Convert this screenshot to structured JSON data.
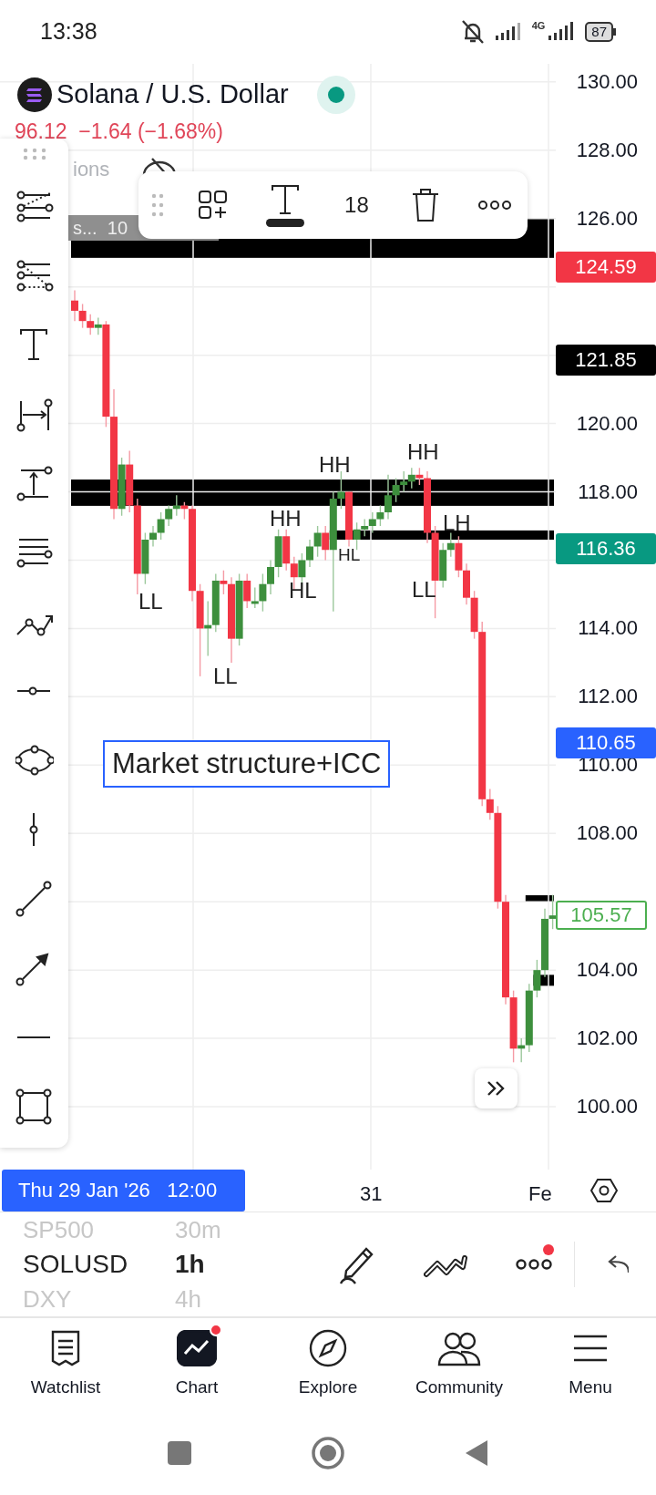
{
  "status_bar": {
    "time": "13:38",
    "network": "4G",
    "battery": "87"
  },
  "header": {
    "title": "Solana / U.S. Dollar",
    "live": true,
    "change": "96.12  −1.64 (−1.68%)"
  },
  "legend": [
    {
      "text": "ions",
      "kind": "plain"
    },
    {
      "text": "s...  10",
      "kind": "tag"
    }
  ],
  "drawing_toolbar": {
    "font_size": "18"
  },
  "chart_data": {
    "type": "candlestick",
    "ylim": [
      98.16,
      130.53
    ],
    "yticks": [
      {
        "value": 130,
        "label": "130.00"
      },
      {
        "value": 128,
        "label": "128.00"
      },
      {
        "value": 126,
        "label": "126.00"
      },
      {
        "value": 120,
        "label": "120.00"
      },
      {
        "value": 118,
        "label": "118.00"
      },
      {
        "value": 114,
        "label": "114.00"
      },
      {
        "value": 112,
        "label": "112.00"
      },
      {
        "value": 110,
        "label": "110.00"
      },
      {
        "value": 108,
        "label": "108.00"
      },
      {
        "value": 104,
        "label": "104.00"
      },
      {
        "value": 102,
        "label": "102.00"
      },
      {
        "value": 100,
        "label": "100.00"
      }
    ],
    "grid": true,
    "categories": [
      null,
      null,
      null,
      null,
      null,
      null,
      null,
      null,
      null,
      null,
      null,
      null,
      null,
      null,
      null,
      null,
      null,
      null,
      null,
      null,
      null,
      null,
      null,
      null,
      null,
      null,
      null,
      null,
      null,
      null,
      null,
      null,
      null,
      null,
      null,
      null,
      null,
      null,
      null,
      null,
      null,
      null,
      null,
      null,
      null,
      null,
      null,
      null,
      null,
      null,
      null,
      null,
      null,
      null,
      null,
      null,
      null,
      null,
      null,
      null,
      null,
      null
    ],
    "ohlc": [
      [
        123.6,
        123.9,
        123.0,
        123.3
      ],
      [
        123.3,
        123.5,
        122.8,
        123.0
      ],
      [
        123.0,
        123.2,
        122.6,
        122.8
      ],
      [
        122.8,
        123.1,
        122.6,
        122.9
      ],
      [
        122.9,
        123.0,
        119.9,
        120.2
      ],
      [
        120.2,
        121.0,
        117.2,
        117.5
      ],
      [
        117.5,
        119.0,
        117.3,
        118.8
      ],
      [
        118.8,
        119.2,
        117.4,
        117.6
      ],
      [
        117.6,
        117.8,
        115.0,
        115.6
      ],
      [
        115.6,
        116.8,
        115.3,
        116.6
      ],
      [
        116.6,
        117.0,
        116.4,
        116.8
      ],
      [
        116.8,
        117.4,
        116.6,
        117.2
      ],
      [
        117.2,
        117.6,
        117.0,
        117.5
      ],
      [
        117.5,
        117.9,
        117.3,
        117.6
      ],
      [
        117.6,
        117.7,
        117.2,
        117.5
      ],
      [
        117.5,
        117.6,
        114.8,
        115.1
      ],
      [
        115.1,
        115.3,
        112.6,
        114.0
      ],
      [
        114.0,
        114.8,
        113.2,
        114.1
      ],
      [
        114.1,
        115.6,
        113.9,
        115.4
      ],
      [
        115.4,
        115.7,
        115.0,
        115.3
      ],
      [
        115.3,
        115.5,
        113.0,
        113.7
      ],
      [
        113.7,
        115.6,
        113.5,
        115.4
      ],
      [
        115.4,
        115.6,
        114.6,
        114.8
      ],
      [
        114.8,
        115.2,
        114.6,
        114.8
      ],
      [
        114.8,
        115.6,
        114.5,
        115.3
      ],
      [
        115.3,
        116.0,
        115.0,
        115.8
      ],
      [
        115.8,
        116.9,
        115.5,
        116.7
      ],
      [
        116.7,
        116.9,
        115.7,
        115.9
      ],
      [
        115.9,
        116.1,
        115.1,
        115.5
      ],
      [
        115.5,
        116.2,
        115.2,
        116.0
      ],
      [
        116.0,
        116.6,
        115.8,
        116.4
      ],
      [
        116.4,
        117.0,
        116.1,
        116.8
      ],
      [
        116.8,
        117.0,
        116.0,
        116.3
      ],
      [
        116.3,
        118.0,
        114.5,
        117.8
      ],
      [
        117.8,
        118.6,
        117.5,
        118.0
      ],
      [
        118.0,
        118.0,
        116.4,
        116.6
      ],
      [
        116.6,
        117.1,
        116.3,
        116.9
      ],
      [
        116.9,
        117.2,
        116.7,
        117.0
      ],
      [
        117.0,
        117.4,
        116.8,
        117.2
      ],
      [
        117.2,
        117.6,
        117.0,
        117.4
      ],
      [
        117.4,
        118.5,
        117.2,
        117.9
      ],
      [
        117.9,
        118.4,
        117.7,
        118.2
      ],
      [
        118.2,
        118.6,
        118.0,
        118.3
      ],
      [
        118.3,
        118.7,
        118.1,
        118.5
      ],
      [
        118.5,
        118.7,
        118.2,
        118.4
      ],
      [
        118.4,
        118.6,
        116.5,
        116.8
      ],
      [
        116.8,
        117.0,
        114.3,
        115.4
      ],
      [
        115.4,
        116.5,
        115.2,
        116.3
      ],
      [
        116.3,
        116.8,
        116.1,
        116.5
      ],
      [
        116.5,
        116.7,
        115.5,
        115.7
      ],
      [
        115.7,
        115.9,
        114.7,
        114.9
      ],
      [
        114.9,
        115.1,
        113.7,
        113.9
      ],
      [
        113.9,
        114.2,
        108.8,
        109.0
      ],
      [
        109.0,
        109.3,
        108.4,
        108.6
      ],
      [
        108.6,
        108.8,
        105.8,
        106.0
      ],
      [
        106.0,
        106.2,
        103.0,
        103.2
      ],
      [
        103.2,
        103.4,
        101.3,
        101.7
      ],
      [
        101.7,
        102.0,
        101.3,
        101.8
      ],
      [
        101.8,
        103.6,
        101.6,
        103.4
      ],
      [
        103.4,
        104.3,
        103.2,
        104.0
      ],
      [
        104.0,
        105.8,
        103.8,
        105.5
      ],
      [
        105.5,
        106.2,
        105.2,
        105.6
      ]
    ]
  },
  "price_badges": [
    {
      "text": "124.59",
      "kind": "filled",
      "color": "#f23645"
    },
    {
      "text": "121.85",
      "kind": "filled",
      "color": "#000000"
    },
    {
      "text": "116.36",
      "kind": "filled",
      "color": "#089981"
    },
    {
      "text": "110.65",
      "kind": "filled",
      "color": "#2962ff"
    },
    {
      "text": "105.57",
      "kind": "outlined",
      "color": "#4caf50"
    }
  ],
  "chart_labels": [
    {
      "text": "LL"
    },
    {
      "text": "LL"
    },
    {
      "text": "HH"
    },
    {
      "text": "HL"
    },
    {
      "text": "HH"
    },
    {
      "text": "HL"
    },
    {
      "text": "HH"
    },
    {
      "text": "LH"
    },
    {
      "text": "LL"
    }
  ],
  "text_box": "Market structure+ICC",
  "time_axis": {
    "crosshair_label": "Thu 29 Jan '26   12:00",
    "ticks": [
      "31",
      "Fe"
    ]
  },
  "symbol_picker": [
    {
      "symbol": "SP500",
      "interval": "30m",
      "selected": false
    },
    {
      "symbol": "SOLUSD",
      "interval": "1h",
      "selected": true
    },
    {
      "symbol": "DXY",
      "interval": "4h",
      "selected": false
    }
  ],
  "more_notification": true,
  "bottom_nav": [
    {
      "label": "Watchlist",
      "selected": false,
      "notification": false
    },
    {
      "label": "Chart",
      "selected": true,
      "notification": true
    },
    {
      "label": "Explore",
      "selected": false,
      "notification": false
    },
    {
      "label": "Community",
      "selected": false,
      "notification": false
    },
    {
      "label": "Menu",
      "selected": false,
      "notification": false
    }
  ]
}
